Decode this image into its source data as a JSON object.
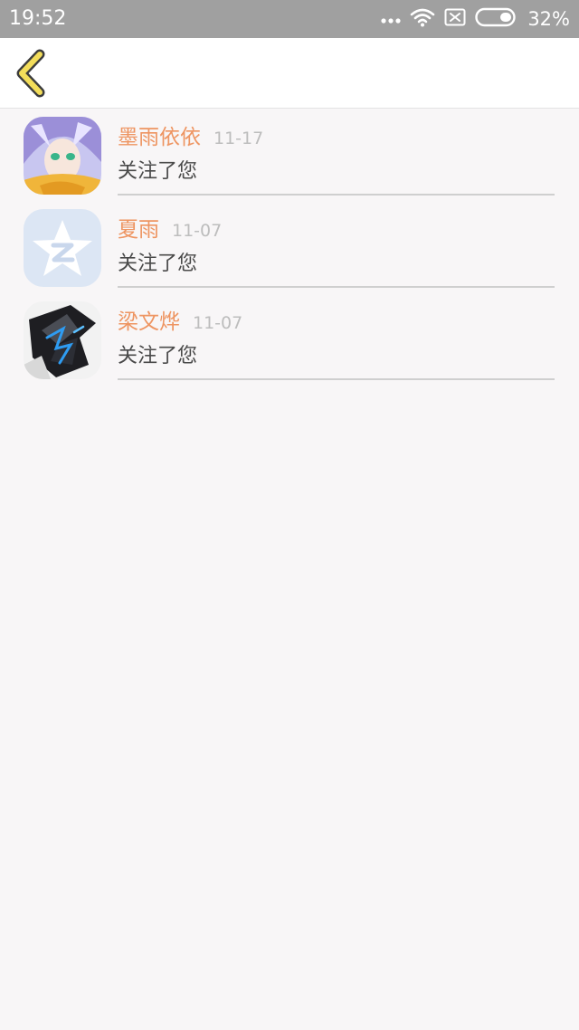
{
  "status_bar": {
    "time": "19:52",
    "battery_percent": "32%",
    "icons": [
      "more-dots-icon",
      "wifi-icon",
      "sim-off-icon",
      "battery-icon"
    ]
  },
  "header": {
    "back_icon": "chevron-left-icon"
  },
  "followers": [
    {
      "name": "墨雨依依",
      "date": "11-17",
      "message": "关注了您"
    },
    {
      "name": "夏雨",
      "date": "11-07",
      "message": "关注了您"
    },
    {
      "name": "梁文烨",
      "date": "11-07",
      "message": "关注了您"
    }
  ],
  "colors": {
    "name": "#ee9562",
    "date": "#bdbdbd",
    "message": "#4a4a4a",
    "back_icon_fill": "#f3dd5a",
    "back_icon_stroke": "#3c3c3c",
    "status_bar": "#a0a0a0",
    "background": "#f8f6f7"
  }
}
